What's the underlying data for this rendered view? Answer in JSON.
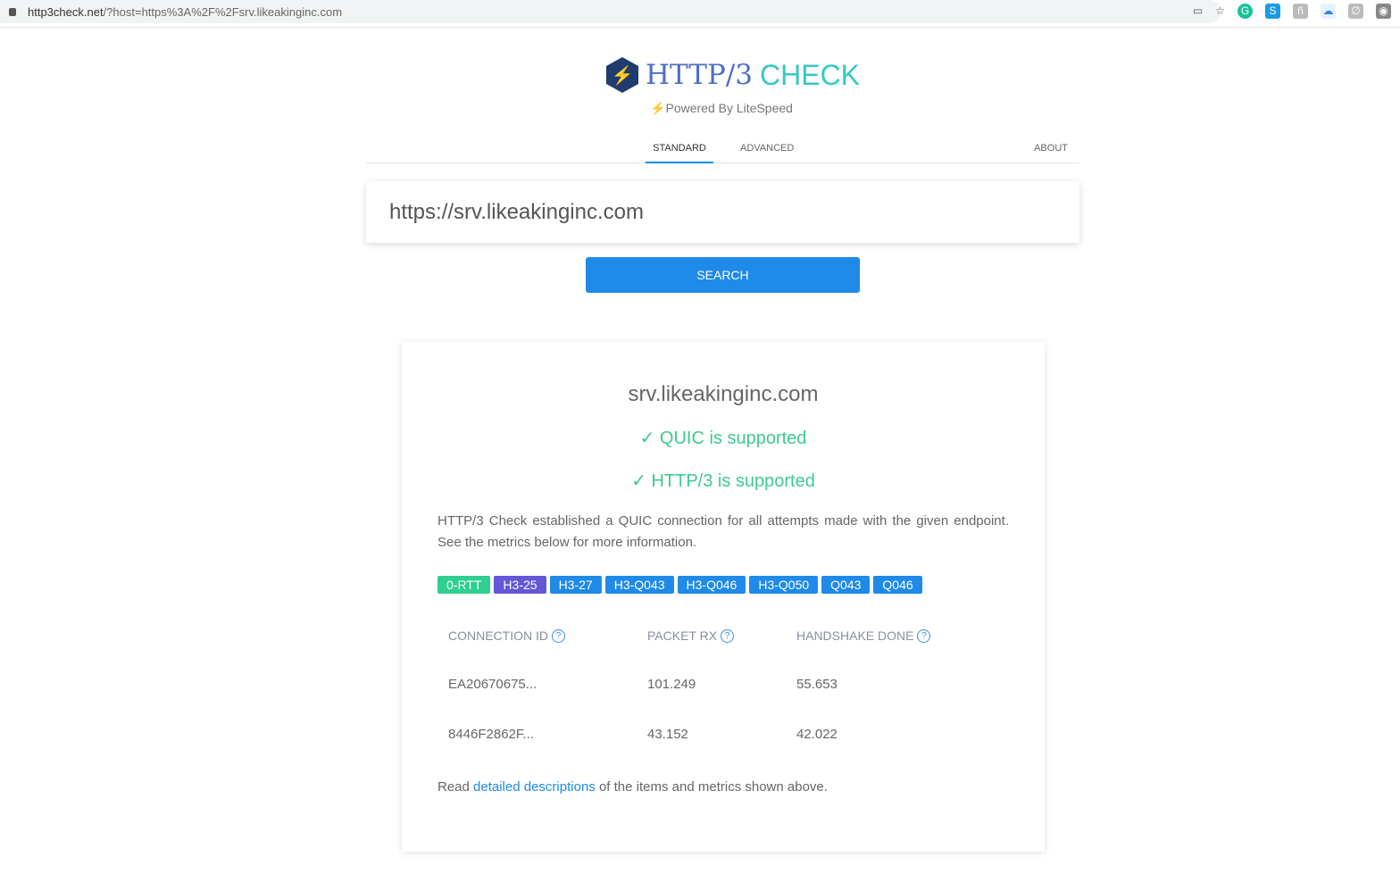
{
  "browser": {
    "url_host": "http3check.net",
    "url_rest": "/?host=https%3A%2F%2Fsrv.likeakinginc.com"
  },
  "header": {
    "title_part1": "HTTP/3",
    "title_part2": "CHECK",
    "powered": "Powered By LiteSpeed"
  },
  "tabs": [
    {
      "label": "STANDARD"
    },
    {
      "label": "ADVANCED"
    },
    {
      "label": "ABOUT"
    }
  ],
  "search": {
    "value": "https://srv.likeakinginc.com",
    "button": "SEARCH"
  },
  "result": {
    "host": "srv.likeakinginc.com",
    "quic": "✓ QUIC is supported",
    "http3": "✓ HTTP/3 is supported",
    "description": "HTTP/3 Check established a QUIC connection for all attempts made with the given endpoint. See the metrics below for more information.",
    "badges": [
      {
        "label": "0-RTT",
        "color": "#2fcf8f"
      },
      {
        "label": "H3-25",
        "color": "#6457d8"
      },
      {
        "label": "H3-27",
        "color": "#1f8ae8"
      },
      {
        "label": "H3-Q043",
        "color": "#1f8ae8"
      },
      {
        "label": "H3-Q046",
        "color": "#1f8ae8"
      },
      {
        "label": "H3-Q050",
        "color": "#1f8ae8"
      },
      {
        "label": "Q043",
        "color": "#1f8ae8"
      },
      {
        "label": "Q046",
        "color": "#1f8ae8"
      }
    ],
    "columns": [
      "CONNECTION ID",
      "PACKET RX",
      "HANDSHAKE DONE"
    ],
    "rows": [
      [
        "EA20670675...",
        "101.249",
        "55.653"
      ],
      [
        "8446F2862F...",
        "43.152",
        "42.022"
      ]
    ],
    "footer_pre": "Read ",
    "footer_link": "detailed descriptions",
    "footer_post": " of the items and metrics shown above."
  }
}
